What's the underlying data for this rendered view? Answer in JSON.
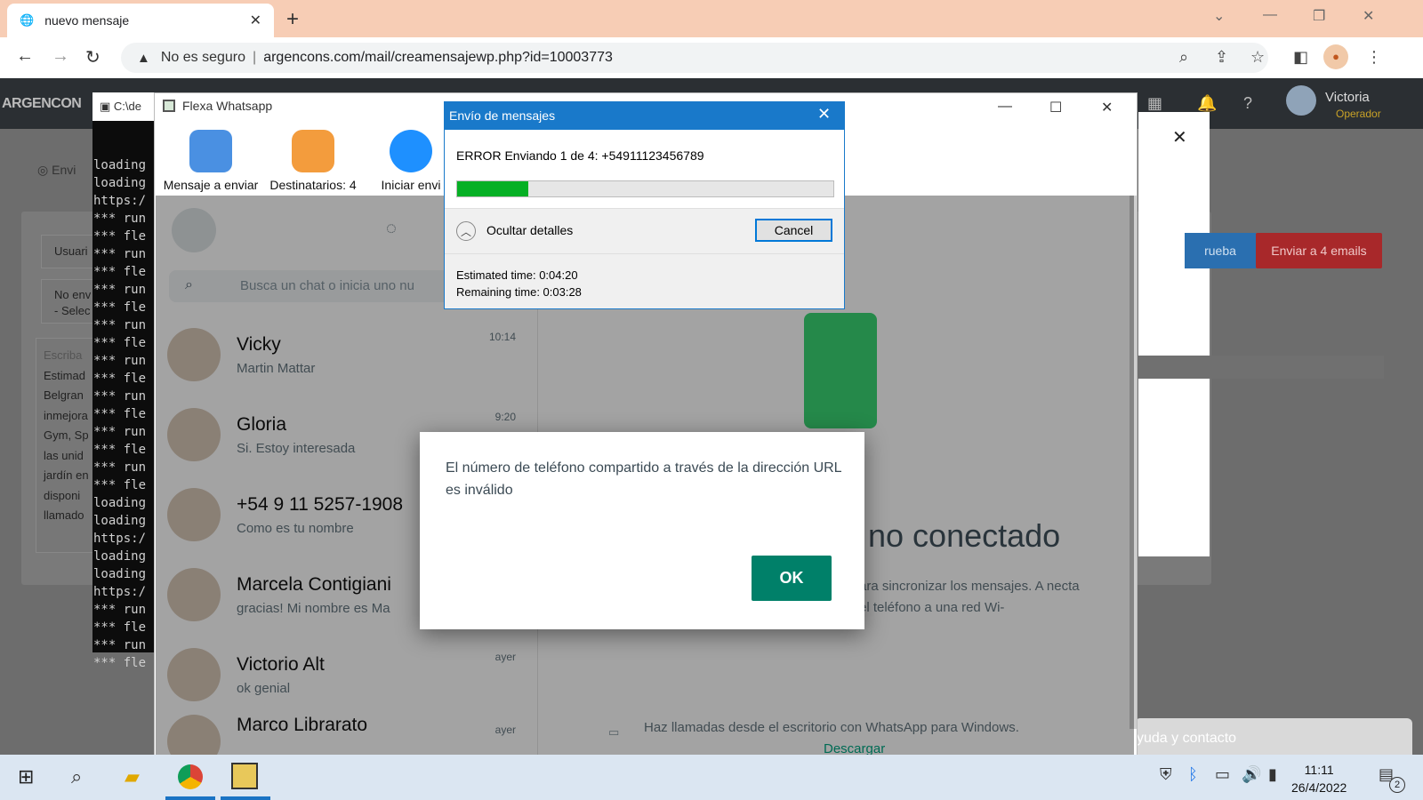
{
  "browser": {
    "tab_title": "nuevo mensaje",
    "url_warning": "No es seguro",
    "url": "argencons.com/mail/creamensajewp.php?id=10003773"
  },
  "site": {
    "logo": "ARGENCON",
    "user_name": "Victoria",
    "user_role": "Operador",
    "envia_label": "Envi",
    "usuario_label": "Usuari",
    "no_env_label": "No env",
    "select_label": "- Selec",
    "escriba_label": "Escriba",
    "body_lines": [
      "Estimad",
      "Belgran",
      "inmejora",
      "Gym, Sp",
      "las unid",
      "jardín en",
      "disponi",
      "llamado"
    ],
    "btn_prueba": "rueba",
    "btn_emails": "Enviar a 4 emails",
    "help_text": "yuda y contacto"
  },
  "console": {
    "title": "C:\\de",
    "lines": [
      "loading",
      "loading",
      "https:/",
      "*** run",
      "*** fle",
      "*** run",
      "*** fle",
      "*** run",
      "*** fle",
      "*** run",
      "*** fle",
      "*** run",
      "*** fle",
      "*** run",
      "*** fle",
      "*** run",
      "*** fle",
      "*** run",
      "*** fle",
      "loading",
      "loading",
      "https:/",
      "loading",
      "loading",
      "https:/",
      "*** run",
      "*** fle",
      "*** run",
      "*** fle"
    ]
  },
  "flexa": {
    "title": "Flexa Whatsapp",
    "toolbar": [
      {
        "label": "Mensaje a enviar"
      },
      {
        "label": "Destinatarios: 4"
      },
      {
        "label": "Iniciar envi"
      }
    ],
    "search_placeholder": "Busca un chat o inicia uno nu",
    "chats": [
      {
        "name": "Vicky",
        "message": "Martin Mattar",
        "time": "10:14"
      },
      {
        "name": "Gloria",
        "message": "Si. Estoy interesada",
        "time": "9:20"
      },
      {
        "name": "+54 9 11 5257-1908",
        "message": "Como es tu nombre",
        "time": ""
      },
      {
        "name": "Marcela Contigiani",
        "message": "gracias! Mi nombre es Ma",
        "time": ""
      },
      {
        "name": "Victorio Alt",
        "message": "ok genial",
        "time": "ayer"
      },
      {
        "name": "Marco Librarato",
        "message": "",
        "time": "ayer"
      }
    ],
    "conn_title": "no conectado",
    "conn_text": "ara sincronizar los mensajes. A necta el teléfono a una red Wi-",
    "calls_text": "Haz llamadas desde el escritorio con WhatsApp para Windows.",
    "download": "Descargar"
  },
  "progress_dialog": {
    "title": "Envío de mensajes",
    "error_text": "ERROR Enviando 1 de 4: +54911123456789",
    "progress": 0.19,
    "details_toggle": "Ocultar detalles",
    "cancel": "Cancel",
    "estimated": "Estimated time: 0:04:20",
    "remaining": "Remaining time: 0:03:28"
  },
  "alert": {
    "message": "El número de teléfono compartido a través de la dirección URL es inválido",
    "ok": "OK"
  },
  "taskbar": {
    "time": "11:11",
    "date": "26/4/2022",
    "notif_count": "2"
  },
  "colors": {
    "chrome_tab_strip": "#f7cdb5",
    "whatsapp_green": "#008069",
    "dialog_blue": "#1979ca",
    "progress_green": "#06b025"
  }
}
